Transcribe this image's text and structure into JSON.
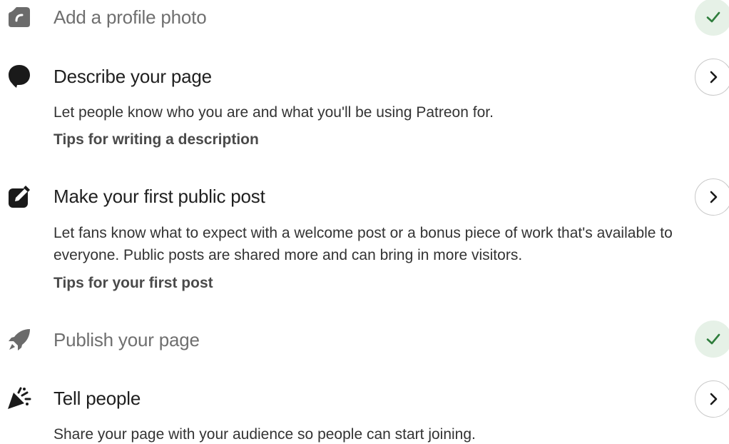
{
  "tasks": [
    {
      "id": "profile-photo",
      "title": "Add a profile photo",
      "status": "done",
      "icon": "camera-icon"
    },
    {
      "id": "describe-page",
      "title": "Describe your page",
      "status": "todo",
      "icon": "speech-bubble-icon",
      "description": "Let people know who you are and what you'll be using Patreon for.",
      "tip": "Tips for writing a description"
    },
    {
      "id": "first-post",
      "title": "Make your first public post",
      "status": "todo",
      "icon": "edit-icon",
      "description": "Let fans know what to expect with a welcome post or a bonus piece of work that's available to everyone. Public posts are shared more and can bring in more visitors.",
      "tip": "Tips for your first post"
    },
    {
      "id": "publish-page",
      "title": "Publish your page",
      "status": "done",
      "icon": "rocket-icon"
    },
    {
      "id": "tell-people",
      "title": "Tell people",
      "status": "todo",
      "icon": "party-popper-icon",
      "description": "Share your page with your audience so people can start joining."
    }
  ],
  "colors": {
    "done_bg": "#e6f1e7",
    "done_check": "#2e7d3c",
    "done_text": "#6f6f6f",
    "todo_text": "#1f1f1f",
    "icon_done": "#6b6b6b",
    "icon_todo": "#1a1a1a"
  }
}
